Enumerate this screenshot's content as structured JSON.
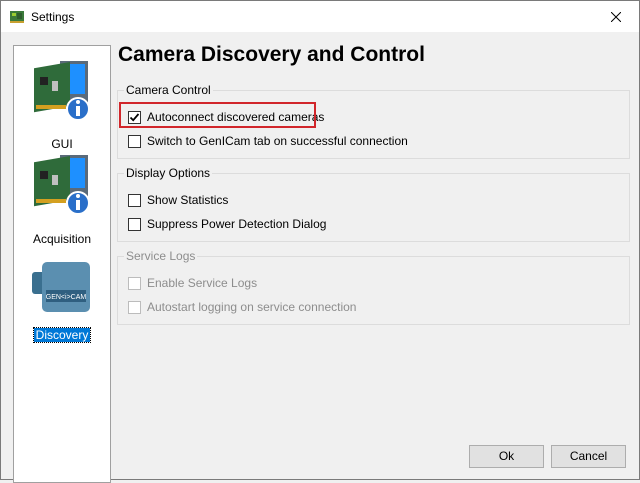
{
  "window": {
    "title": "Settings"
  },
  "sidebar": {
    "items": [
      {
        "label": "GUI",
        "icon": "network-card-info-icon",
        "selected": false
      },
      {
        "label": "Acquisition",
        "icon": "network-card-info-icon",
        "selected": false
      },
      {
        "label": "Discovery",
        "icon": "genicam-camera-icon",
        "selected": true
      }
    ]
  },
  "page": {
    "title": "Camera Discovery and Control"
  },
  "groups": {
    "camera_control": {
      "legend": "Camera Control",
      "options": [
        {
          "label": "Autoconnect discovered cameras",
          "checked": true,
          "enabled": true
        },
        {
          "label": "Switch to GenICam tab on successful connection",
          "checked": false,
          "enabled": true
        }
      ]
    },
    "display_options": {
      "legend": "Display Options",
      "options": [
        {
          "label": "Show Statistics",
          "checked": false,
          "enabled": true
        },
        {
          "label": "Suppress Power Detection Dialog",
          "checked": false,
          "enabled": true
        }
      ]
    },
    "service_logs": {
      "legend": "Service Logs",
      "options": [
        {
          "label": "Enable Service Logs",
          "checked": false,
          "enabled": false
        },
        {
          "label": "Autostart logging on service connection",
          "checked": false,
          "enabled": false
        }
      ]
    }
  },
  "camera_logo_text": "GEN<i>CAM",
  "buttons": {
    "ok": "Ok",
    "cancel": "Cancel"
  },
  "colors": {
    "highlight": "#d1262b",
    "selection": "#0078d7"
  }
}
